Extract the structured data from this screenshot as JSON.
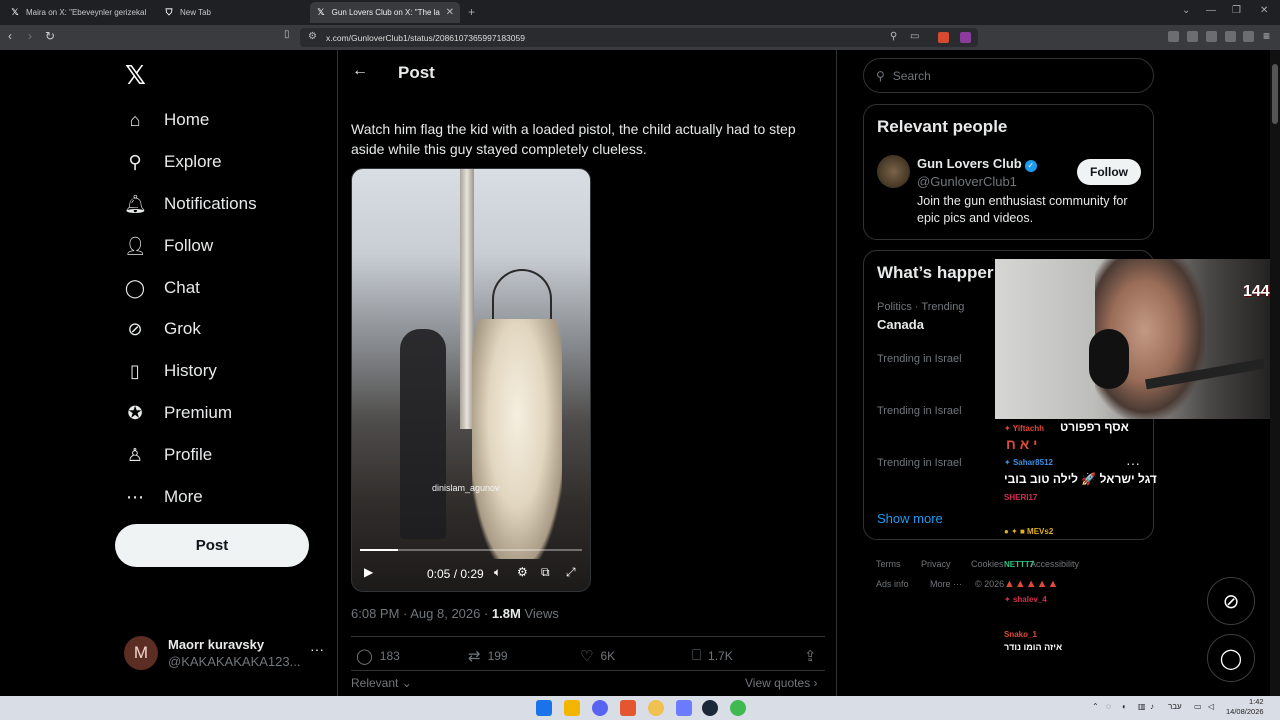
{
  "browser": {
    "tabs": [
      {
        "title": "Maira on X: \"Ebeveynler gerizekalı ol",
        "icon": "x-logo-icon"
      },
      {
        "title": "New Tab",
        "icon": "shield-icon"
      },
      {
        "title": "Gun Lovers Club on X: \"The lack",
        "icon": "x-logo-icon"
      }
    ],
    "url": "x.com/GunloverClub1/status/2086107365997183059",
    "window_controls": [
      "⌄",
      "—",
      "❐",
      "✕"
    ]
  },
  "sidebar": {
    "logo": "𝕏",
    "items": [
      {
        "label": "Home",
        "icon": "home-icon",
        "glyph": "⌂"
      },
      {
        "label": "Explore",
        "icon": "search-icon",
        "glyph": "⚲"
      },
      {
        "label": "Notifications",
        "icon": "bell-icon",
        "glyph": "🔔︎"
      },
      {
        "label": "Follow",
        "icon": "add-person-icon",
        "glyph": "👤︎"
      },
      {
        "label": "Chat",
        "icon": "chat-bubble-icon",
        "glyph": "◯"
      },
      {
        "label": "Grok",
        "icon": "grok-icon",
        "glyph": "⊘"
      },
      {
        "label": "History",
        "icon": "bookmark-icon",
        "glyph": "▯"
      },
      {
        "label": "Premium",
        "icon": "verified-badge-icon",
        "glyph": "✪"
      },
      {
        "label": "Profile",
        "icon": "person-icon",
        "glyph": "♙"
      },
      {
        "label": "More",
        "icon": "more-circle-icon",
        "glyph": "⋯"
      }
    ],
    "post_button": "Post",
    "account": {
      "initial": "M",
      "name": "Maorr kuravsky",
      "handle": "@KAKAKAKAKA123...",
      "menu": "···"
    }
  },
  "main": {
    "header_title": "Post",
    "back_glyph": "←",
    "tweet_text": "Watch him flag the kid with a loaded pistol, the child actually had to step aside while this guy stayed completely clueless.",
    "video": {
      "watermark": "dinislam_agunov",
      "time": "0:05 / 0:29",
      "progress": 0.17
    },
    "meta": {
      "time": "6:08 PM · Aug 8, 2026 · ",
      "views_count": "1.8M",
      "views_label": " Views"
    },
    "actions": [
      {
        "icon": "reply-icon",
        "glyph": "◯",
        "count": "183"
      },
      {
        "icon": "repost-icon",
        "glyph": "⇄",
        "count": "199"
      },
      {
        "icon": "like-icon",
        "glyph": "♡",
        "count": "6K"
      },
      {
        "icon": "bookmark-icon",
        "glyph": "⎕",
        "count": "1.7K"
      },
      {
        "icon": "share-icon",
        "glyph": "⇪",
        "count": ""
      }
    ],
    "relevant_label": "Relevant",
    "view_quotes": "View quotes ›"
  },
  "right": {
    "search_placeholder": "Search",
    "relevant_people": {
      "title": "Relevant people",
      "name": "Gun Lovers Club",
      "handle": "@GunloverClub1",
      "bio": "Join the gun enthusiast community for epic pics and videos.",
      "follow": "Follow"
    },
    "happening": {
      "title": "What’s happer",
      "trends": [
        {
          "sub": "Politics · Trending",
          "main": "Canada"
        },
        {
          "sub": "Trending in Israel",
          "main": ""
        },
        {
          "sub": "Trending in Israel",
          "main": ""
        },
        {
          "sub": "Trending in Israel",
          "main": ""
        }
      ],
      "show_more": "Show more"
    },
    "footer": {
      "row1": [
        "Terms",
        "Privacy",
        "Cookies",
        "Accessibility"
      ],
      "row2": [
        "Ads info",
        "More ···",
        "© 2026"
      ]
    }
  },
  "overlay": {
    "cam_badge": "144",
    "chat": [
      {
        "user": "Yiftachh",
        "color": "#e04a3a",
        "message": "אסף רפפורט"
      },
      {
        "user": "",
        "color": "#e04a3a",
        "message": "י א ח"
      },
      {
        "user": "Sahar8512",
        "color": "#3d8fe0",
        "message": "דגל ישראל 🚀 לילה טוב בובי"
      },
      {
        "user": "SHERI17",
        "color": "#d03050",
        "message": ""
      },
      {
        "user": "MEVs2",
        "color": "#e0b020",
        "message": ""
      },
      {
        "user": "NETTT7",
        "color": "#2ec27e",
        "message": ""
      },
      {
        "user": "shalev_4",
        "color": "#d03050",
        "message": ""
      },
      {
        "user": "Snako_1",
        "color": "#e04a3a",
        "message": "איזה הומו נודר"
      }
    ]
  },
  "taskbar": {
    "time": "1:42",
    "date": "14/08/2026",
    "lang": "עבר"
  },
  "colors": {
    "accent": "#1d9bf0",
    "background": "#000000",
    "border": "#2f3336",
    "muted": "#71767b"
  }
}
